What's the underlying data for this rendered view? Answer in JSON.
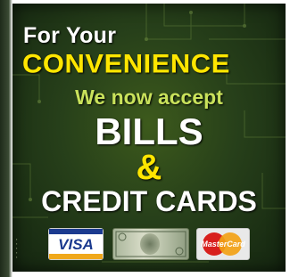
{
  "sign": {
    "line1": "For Your",
    "line2": "CONVENIENCE",
    "line3": "We now accept",
    "line4": "BILLS",
    "line5": "&",
    "line6": "CREDIT CARDS"
  },
  "cards": {
    "visa_label": "VISA",
    "mastercard_label": "MasterCard"
  },
  "colors": {
    "background": "#27401a",
    "yellow": "#ffe600",
    "green_text": "#c9e25b",
    "white": "#ffffff"
  },
  "icons": [
    "visa-card-icon",
    "dollar-bill-icon",
    "mastercard-icon"
  ]
}
